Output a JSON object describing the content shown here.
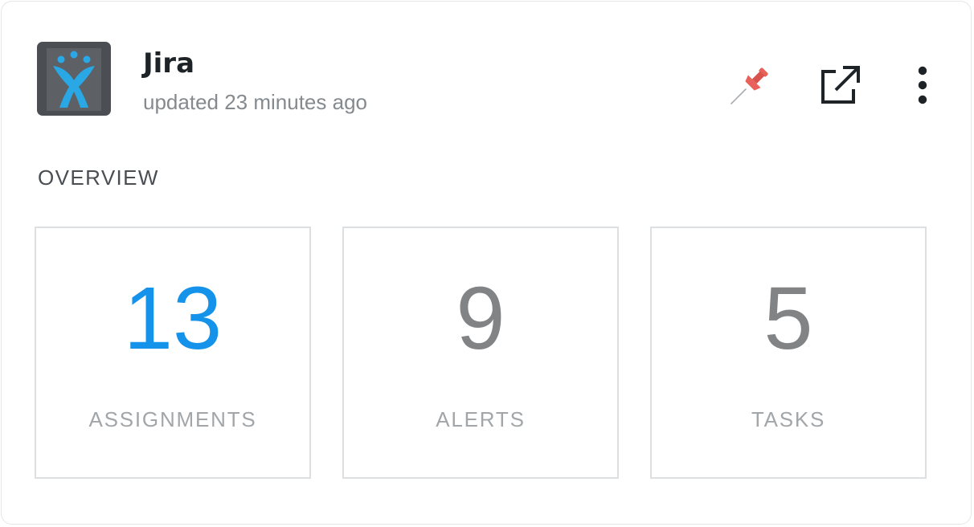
{
  "app": {
    "name": "Jira",
    "updated": "updated 23 minutes ago",
    "logo_icon": "jira-logo-icon"
  },
  "actions": {
    "pin_icon": "pushpin-icon",
    "external_icon": "external-link-icon",
    "more_icon": "more-vertical-icon"
  },
  "overview": {
    "title": "OVERVIEW",
    "stats": [
      {
        "value": "13",
        "label": "ASSIGNMENTS",
        "color": "#1593eb"
      },
      {
        "value": "9",
        "label": "ALERTS",
        "color": "#828385"
      },
      {
        "value": "5",
        "label": "TASKS",
        "color": "#828385"
      }
    ]
  },
  "colors": {
    "accent": "#1593eb",
    "logo_bg": "#4b4e52",
    "logo_figure": "#2aa7e5",
    "pin": "#e8615a"
  }
}
